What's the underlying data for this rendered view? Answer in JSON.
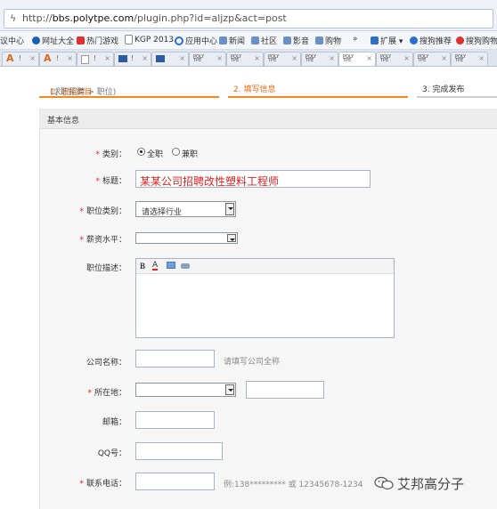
{
  "browser": {
    "url_prefix": "http://",
    "url_domain": "bbs.polytpe.com",
    "url_path": "/plugin.php?id=aljzp&act=post"
  },
  "favorites": [
    {
      "label": "议中心",
      "icon": "none",
      "color": ""
    },
    {
      "label": "网址大全",
      "icon": "s-logo-icon",
      "color": "#1a5fb4"
    },
    {
      "label": "热门游戏",
      "icon": "game-icon",
      "color": "#e03030"
    },
    {
      "label": "KGP 2013",
      "icon": "page-icon",
      "color": "#888888"
    },
    {
      "label": "应用中心",
      "icon": "app-center-icon",
      "color": "#2a6fd0"
    },
    {
      "label": "新闻",
      "icon": "folder-icon",
      "color": "#6b8fc7"
    },
    {
      "label": "社区",
      "icon": "folder-icon",
      "color": "#6b8fc7"
    },
    {
      "label": "影音",
      "icon": "folder-icon",
      "color": "#6b8fc7"
    },
    {
      "label": "购物",
      "icon": "folder-icon",
      "color": "#6b8fc7"
    },
    {
      "label": "»",
      "icon": "none",
      "color": ""
    },
    {
      "label": "扩展 ▾",
      "icon": "grid-icon",
      "color": "#3070c0"
    },
    {
      "label": "搜狗推荐",
      "icon": "sogou-icon",
      "color": "#2a6fd0"
    },
    {
      "label": "搜狗购物",
      "icon": "sogou-shop-icon",
      "color": "#e03030"
    }
  ],
  "tabs": [
    {
      "icon": "a",
      "mark": "!",
      "close": "×"
    },
    {
      "icon": "a",
      "mark": "!",
      "close": "×"
    },
    {
      "icon": "page",
      "mark": "!",
      "close": "×"
    },
    {
      "icon": "blue",
      "mark": "!",
      "close": "×"
    },
    {
      "icon": "blue",
      "mark": "",
      "close": "×"
    },
    {
      "icon": "poly",
      "mark": "",
      "close": "×"
    },
    {
      "icon": "poly",
      "mark": "",
      "close": "×"
    },
    {
      "icon": "poly",
      "mark": "",
      "close": "×"
    },
    {
      "icon": "poly",
      "mark": "",
      "close": "×"
    },
    {
      "icon": "poly",
      "mark": "",
      "close": "×"
    },
    {
      "icon": "poly",
      "mark": "",
      "close": "×"
    },
    {
      "icon": "poly",
      "mark": "",
      "close": "×"
    },
    {
      "icon": "poly",
      "mark": "",
      "close": "×"
    }
  ],
  "steps": {
    "step1": "1. 选择类目",
    "step1_sub": "(求职招聘 > 职位)",
    "step2": "2. 填写信息",
    "step3": "3. 完成发布"
  },
  "section_title": "基本信息",
  "form": {
    "category_label": "类别：",
    "category_opt1": "全职",
    "category_opt2": "兼职",
    "category_selected": "全职",
    "title_label": "标题：",
    "title_value": "某某公司招聘改性塑料工程师",
    "job_category_label": "职位类别：",
    "job_category_value": "请选择行业",
    "salary_label": "薪资水平：",
    "salary_value": "",
    "desc_label": "职位描述：",
    "toolbar_bold": "B",
    "toolbar_font": "A",
    "company_label": "公司名称：",
    "company_hint": "请填写公司全称",
    "location_label": "所在地：",
    "email_label": "邮箱：",
    "qq_label": "QQ号：",
    "phone_label": "联系电话：",
    "phone_hint": "例:138********* 或 12345678-1234"
  },
  "watermark": "艾邦高分子",
  "colors": {
    "accent_orange": "#f08a1c",
    "required_red": "#e02020"
  }
}
